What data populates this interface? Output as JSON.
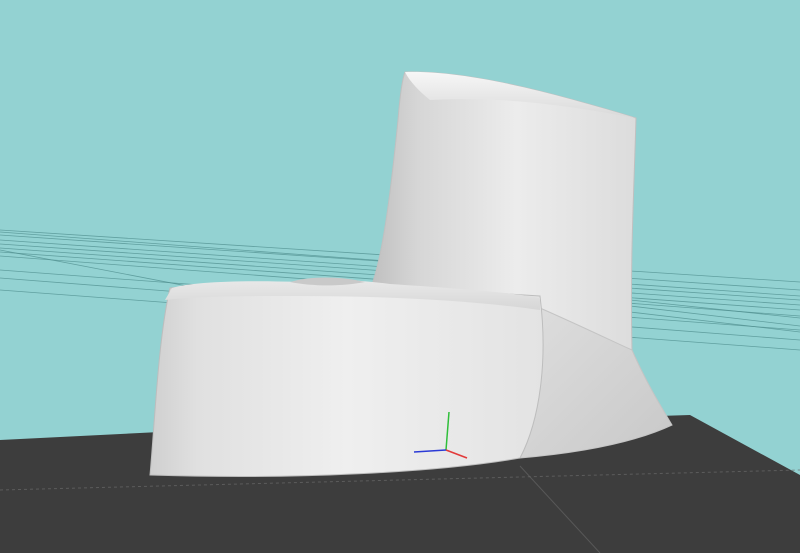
{
  "viewport": {
    "background_color": "#93d2d2",
    "ground_plane_color": "#3d3d3d",
    "grid_line_color": "#4f8e8e",
    "model_color": "#e6e6e6"
  },
  "axis_gizmo": {
    "x_color": "#e23b3b",
    "y_color": "#2fbf3a",
    "z_color": "#2b3ad6"
  }
}
